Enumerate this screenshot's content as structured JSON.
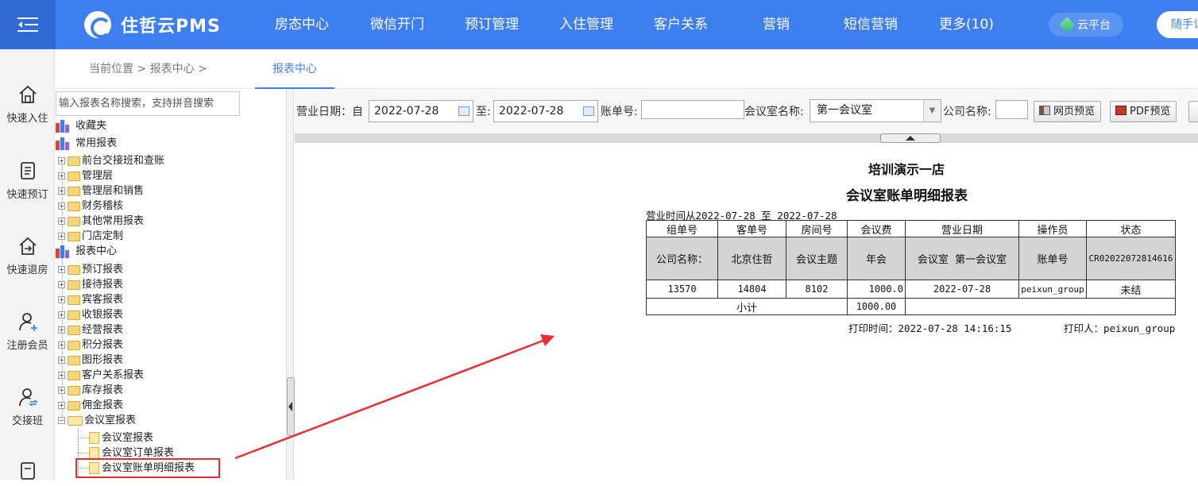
{
  "app": {
    "brand": "住哲云PMS",
    "nav": [
      "房态中心",
      "微信开门",
      "预订管理",
      "入住管理",
      "客户关系",
      "营销",
      "短信营销",
      "更多(10)"
    ],
    "cloud_label": "云平台",
    "hand_label": "随手记"
  },
  "quickbar": [
    {
      "label": "快速入住",
      "icon": "home-in-icon"
    },
    {
      "label": "快速预订",
      "icon": "booking-icon"
    },
    {
      "label": "快速退房",
      "icon": "home-out-icon"
    },
    {
      "label": "注册会员",
      "icon": "add-user-icon"
    },
    {
      "label": "交接班",
      "icon": "shift-icon"
    }
  ],
  "breadcrumb": {
    "text": "当前位置 > 报表中心 >",
    "tab": "报表中心"
  },
  "tree": {
    "search_placeholder": "输入报表名称搜索，支持拼音搜索",
    "favorites": "收藏夹",
    "common": "常用报表",
    "common_items": [
      "前台交接班和查账",
      "管理层",
      "管理层和销售",
      "财务稽核",
      "其他常用报表",
      "门店定制"
    ],
    "report_center": "报表中心",
    "center_items": [
      "预订报表",
      "接待报表",
      "宾客报表",
      "收银报表",
      "经营报表",
      "积分报表",
      "图形报表",
      "客户关系报表",
      "库存报表",
      "佣金报表"
    ],
    "meeting_folder": "会议室报表",
    "meeting_items": [
      "会议室报表",
      "会议室订单报表",
      "会议室账单明细报表"
    ]
  },
  "filters": {
    "date_label": "营业日期：自",
    "date_from": "2022-07-28",
    "to_label": "至:",
    "date_to": "2022-07-28",
    "bill_label": "账单号:",
    "bill_value": "",
    "room_label": "会议室名称:",
    "room_value": "第一会议室",
    "company_label": "公司名称:",
    "company_value": "",
    "web_preview": "网页预览",
    "pdf_preview": "PDF预览"
  },
  "report": {
    "hotel": "培训演示一店",
    "title": "会议室账单明细报表",
    "period": "营业时间从2022-07-28 至 2022-07-28",
    "columns": [
      "组单号",
      "客单号",
      "房间号",
      "会议费",
      "营业日期",
      "操作员",
      "状态"
    ],
    "group_row": [
      "公司名称：",
      "北京住哲",
      "会议主题",
      "年会",
      "会议室  第一会议室",
      "账单号",
      "CR02022072814616"
    ],
    "rows": [
      [
        "13570",
        "14804",
        "8102",
        "1000.0",
        "2022-07-28",
        "peixun_group",
        "未结"
      ]
    ],
    "subtotal_label": "小计",
    "subtotal_value": "1000.00",
    "print_time": "打印时间：2022-07-28 14:16:15",
    "printer": "打印人：peixun_group"
  },
  "colors": {
    "brand_blue": "#3d7ff0",
    "annotation_red": "#e53030"
  }
}
